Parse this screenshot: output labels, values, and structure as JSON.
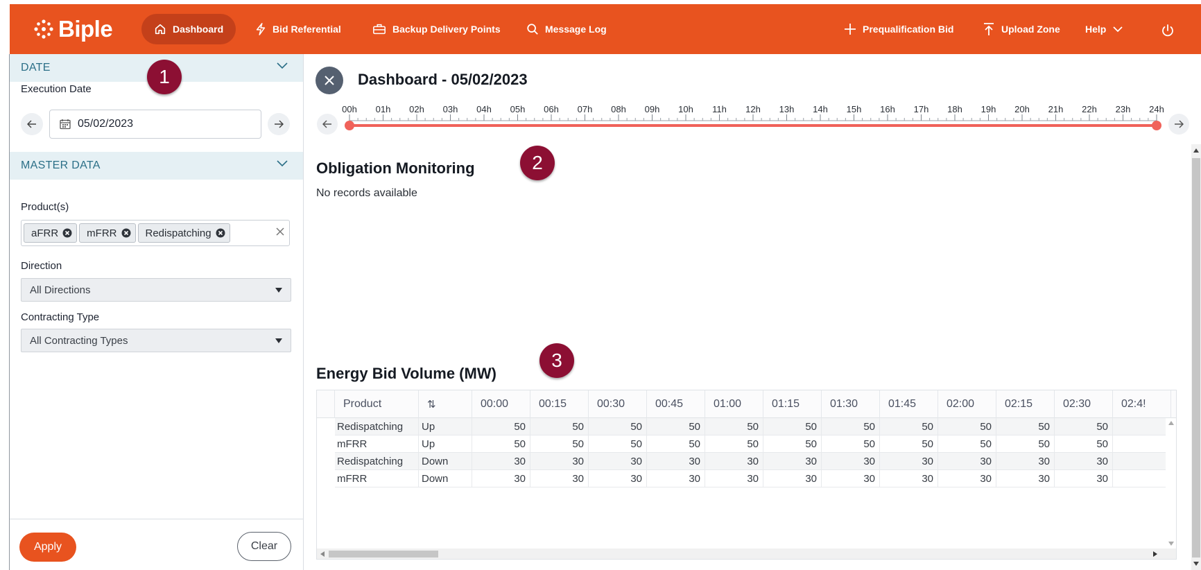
{
  "brand": {
    "name": "Biple",
    "accent": "#e8531f",
    "badge_color": "#8c0f33"
  },
  "nav": {
    "dashboard": "Dashboard",
    "bid_referential": "Bid Referential",
    "backup_delivery": "Backup Delivery Points",
    "message_log": "Message Log",
    "prequalification": "Prequalification Bid",
    "upload_zone": "Upload Zone",
    "help": "Help"
  },
  "sidebar": {
    "date_section": "DATE",
    "execution_date_label": "Execution Date",
    "execution_date_value": "05/02/2023",
    "master_section": "MASTER DATA",
    "products_label": "Product(s)",
    "products": [
      "aFRR",
      "mFRR",
      "Redispatching"
    ],
    "direction_label": "Direction",
    "direction_value": "All Directions",
    "contracting_label": "Contracting Type",
    "contracting_value": "All Contracting Types",
    "apply": "Apply",
    "clear": "Clear"
  },
  "badges": [
    "1",
    "2",
    "3"
  ],
  "main": {
    "title": "Dashboard - 05/02/2023",
    "timeline_hours": [
      "00h",
      "01h",
      "02h",
      "03h",
      "04h",
      "05h",
      "06h",
      "07h",
      "08h",
      "09h",
      "10h",
      "11h",
      "12h",
      "13h",
      "14h",
      "15h",
      "16h",
      "17h",
      "18h",
      "19h",
      "20h",
      "21h",
      "22h",
      "23h",
      "24h"
    ],
    "timeline_range": [
      "00h",
      "24h"
    ],
    "obligation_title": "Obligation Monitoring",
    "obligation_empty": "No records available",
    "energy_title": "Energy Bid Volume (MW)"
  },
  "grid": {
    "header_product": "Product",
    "header_sort": "⇅",
    "time_columns": [
      "00:00",
      "00:15",
      "00:30",
      "00:45",
      "01:00",
      "01:15",
      "01:30",
      "01:45",
      "02:00",
      "02:15",
      "02:30",
      "02:4!"
    ],
    "rows": [
      {
        "product": "Redispatching",
        "direction": "Up",
        "values": [
          "50",
          "50",
          "50",
          "50",
          "50",
          "50",
          "50",
          "50",
          "50",
          "50",
          "50"
        ]
      },
      {
        "product": "mFRR",
        "direction": "Up",
        "values": [
          "50",
          "50",
          "50",
          "50",
          "50",
          "50",
          "50",
          "50",
          "50",
          "50",
          "50"
        ]
      },
      {
        "product": "Redispatching",
        "direction": "Down",
        "values": [
          "30",
          "30",
          "30",
          "30",
          "30",
          "30",
          "30",
          "30",
          "30",
          "30",
          "30"
        ]
      },
      {
        "product": "mFRR",
        "direction": "Down",
        "values": [
          "30",
          "30",
          "30",
          "30",
          "30",
          "30",
          "30",
          "30",
          "30",
          "30",
          "30"
        ]
      }
    ]
  }
}
